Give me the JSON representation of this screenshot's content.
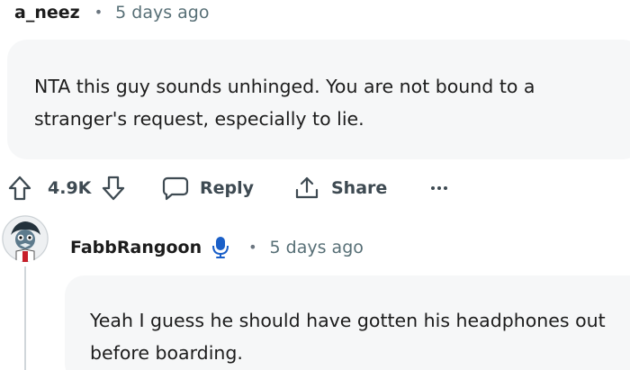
{
  "comment1": {
    "username": "a_neez",
    "separator": "•",
    "time": "5 days ago",
    "body": "NTA this guy sounds unhinged. You are not bound to a stranger's request, especially to lie."
  },
  "actions": {
    "score": "4.9K",
    "reply_label": "Reply",
    "share_label": "Share",
    "more_label": "•••"
  },
  "comment2": {
    "username": "FabbRangoon",
    "separator": "•",
    "time": "5 days ago",
    "body": "Yeah I guess he should have gotten his headphones out before boarding."
  },
  "icons": {
    "upvote": "arrow-up-icon",
    "downvote": "arrow-down-icon",
    "reply": "chat-bubble-icon",
    "share": "share-icon",
    "more": "ellipsis-icon",
    "flair": "microphone-icon"
  },
  "colors": {
    "bubble_bg": "#f6f7f8",
    "meta_text": "#576f76",
    "action_text": "#3e4a52",
    "flair_blue": "#1a5fc8"
  }
}
